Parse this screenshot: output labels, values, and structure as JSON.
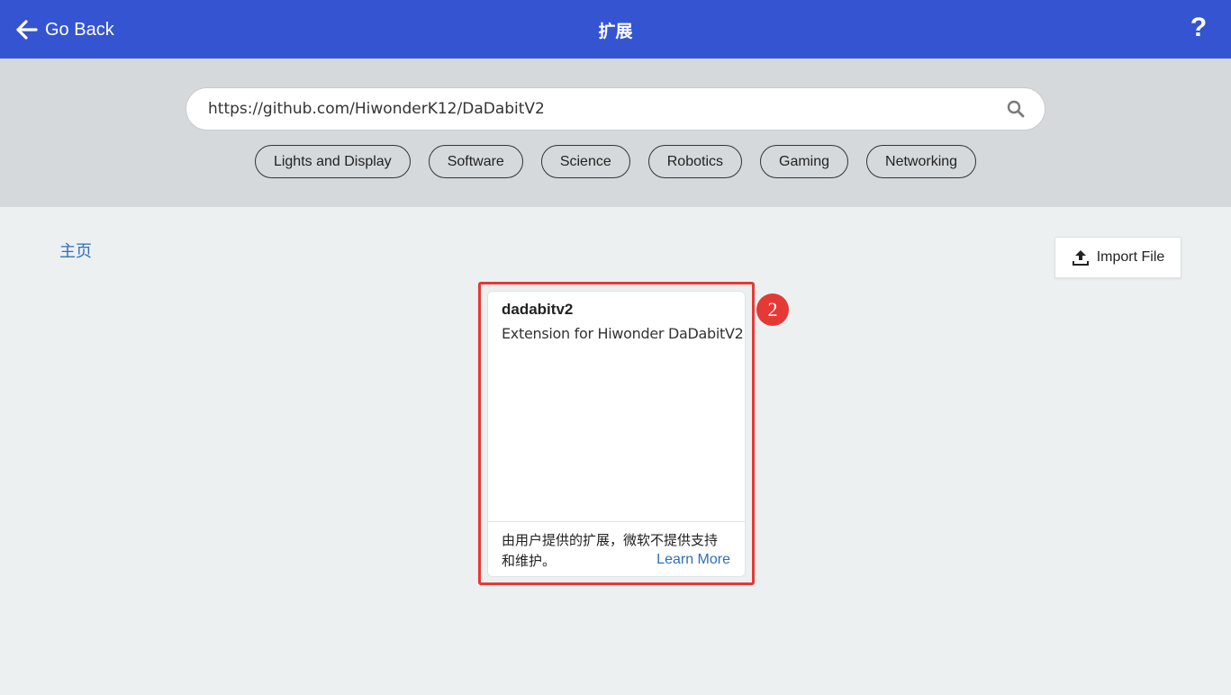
{
  "header": {
    "back_label": "Go Back",
    "title": "扩展",
    "help_label": "?"
  },
  "search": {
    "value": "https://github.com/HiwonderK12/DaDabitV2",
    "placeholder": ""
  },
  "tags": [
    "Lights and Display",
    "Software",
    "Science",
    "Robotics",
    "Gaming",
    "Networking"
  ],
  "breadcrumb": {
    "home": "主页"
  },
  "import_button": {
    "label": "Import File"
  },
  "card": {
    "title": "dadabitv2",
    "description": "Extension for Hiwonder DaDabitV2",
    "note": "由用户提供的扩展，微软不提供支持和维护。",
    "learn_more": "Learn More"
  },
  "annotation": {
    "badge": "2"
  },
  "colors": {
    "header_bg": "#3454d1",
    "search_band": "#d6d9db",
    "page_bg": "#ecf0f1",
    "link": "#2f6fb8",
    "highlight": "#e53935"
  }
}
